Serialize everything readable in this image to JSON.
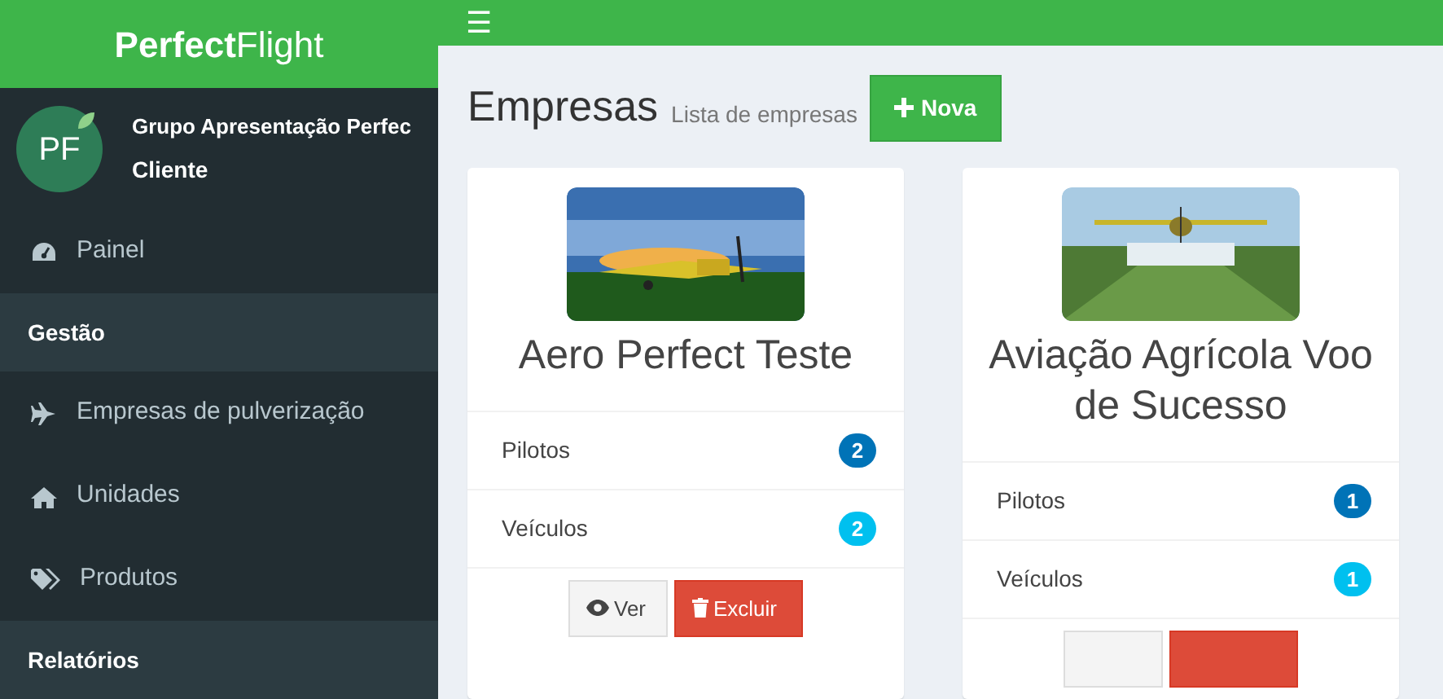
{
  "brand": {
    "bold": "Perfect",
    "light": "Flight"
  },
  "user": {
    "avatar_text": "PF",
    "name": "Grupo Apresentação Perfec",
    "role": "Cliente"
  },
  "topbar": {
    "menu_icon": "☰"
  },
  "sidebar": {
    "items": [
      {
        "kind": "link",
        "label": "Painel"
      },
      {
        "kind": "header",
        "label": "Gestão"
      },
      {
        "kind": "link",
        "label": "Empresas de pulverização"
      },
      {
        "kind": "link",
        "label": "Unidades"
      },
      {
        "kind": "link",
        "label": "Produtos"
      },
      {
        "kind": "header",
        "label": "Relatórios"
      }
    ]
  },
  "page_header": {
    "title": "Empresas",
    "subtitle": "Lista de empresas",
    "button": "Nova"
  },
  "companies": [
    {
      "name": "Aero Perfect Teste",
      "stats": [
        {
          "label": "Pilotos",
          "count": "2",
          "kind": "primary"
        },
        {
          "label": "Veículos",
          "count": "2",
          "kind": "info"
        }
      ],
      "buttons": [
        {
          "kind": "view",
          "label": "Ver"
        },
        {
          "kind": "delete",
          "label": "Excluir"
        }
      ]
    },
    {
      "name": "Aviação Agrícola Voo de Sucesso",
      "stats": [
        {
          "label": "Pilotos",
          "count": "1",
          "kind": "primary"
        },
        {
          "label": "Veículos",
          "count": "1",
          "kind": "info"
        }
      ],
      "buttons": [
        {
          "kind": "view"
        },
        {
          "kind": "delete"
        }
      ]
    }
  ]
}
